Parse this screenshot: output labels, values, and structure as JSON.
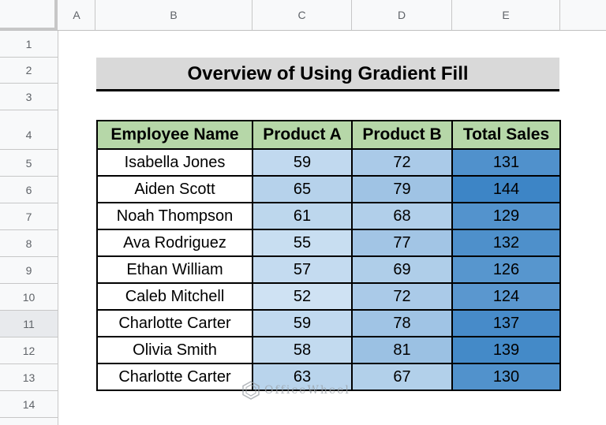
{
  "sheet": {
    "columns": [
      "A",
      "B",
      "C",
      "D",
      "E",
      ""
    ],
    "rows": [
      "1",
      "2",
      "3",
      "4",
      "5",
      "6",
      "7",
      "8",
      "9",
      "10",
      "11",
      "12",
      "13",
      "14"
    ],
    "selected_row": "11"
  },
  "title": "Overview of Using Gradient Fill",
  "table": {
    "headers": [
      "Employee Name",
      "Product A",
      "Product B",
      "Total Sales"
    ],
    "rows": [
      [
        "Isabella Jones",
        "59",
        "72",
        "131"
      ],
      [
        "Aiden Scott",
        "65",
        "79",
        "144"
      ],
      [
        "Noah Thompson",
        "61",
        "68",
        "129"
      ],
      [
        "Ava Rodriguez",
        "55",
        "77",
        "132"
      ],
      [
        "Ethan William",
        "57",
        "69",
        "126"
      ],
      [
        "Caleb Mitchell",
        "52",
        "72",
        "124"
      ],
      [
        "Charlotte Carter",
        "59",
        "78",
        "137"
      ],
      [
        "Olivia Smith",
        "58",
        "81",
        "139"
      ],
      [
        "Charlotte Carter",
        "63",
        "67",
        "130"
      ]
    ]
  },
  "colors": {
    "header_fill": "#b6d7a8",
    "title_fill": "#d9d9d9",
    "gradient_low": "#cfe2f3",
    "gradient_high": "#3d85c6"
  },
  "watermark": {
    "text": "OfficeWheel",
    "icon": "officewheel-logo-icon"
  }
}
